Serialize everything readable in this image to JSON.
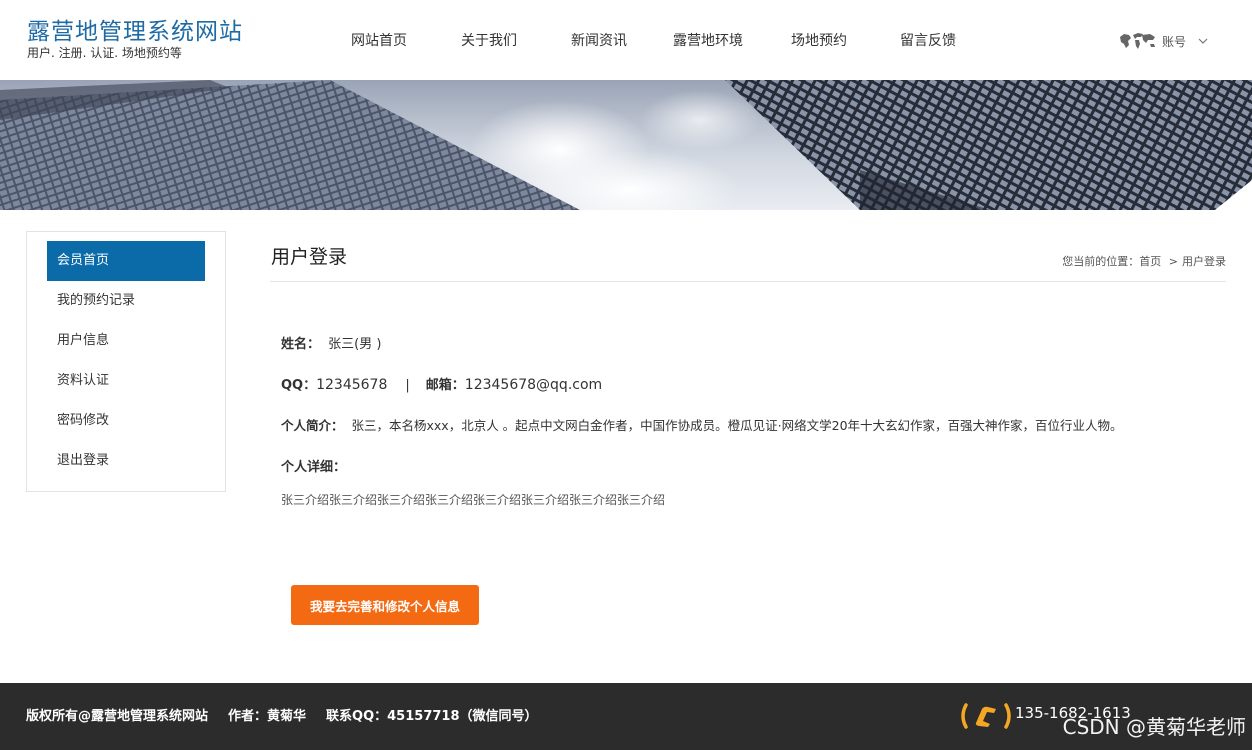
{
  "header": {
    "site_title": "露营地管理系统网站",
    "site_subtitle": "用户. 注册. 认证. 场地预约等",
    "nav": [
      {
        "label": "网站首页"
      },
      {
        "label": "关于我们"
      },
      {
        "label": "新闻资讯"
      },
      {
        "label": "露营地环境"
      },
      {
        "label": "场地预约"
      },
      {
        "label": "留言反馈"
      }
    ],
    "account_label": "账号",
    "account_icon": "world-map-icon"
  },
  "sidebar": {
    "items": [
      {
        "label": "会员首页",
        "active": true
      },
      {
        "label": "我的预约记录"
      },
      {
        "label": "用户信息"
      },
      {
        "label": "资料认证"
      },
      {
        "label": "密码修改"
      },
      {
        "label": "退出登录"
      }
    ]
  },
  "main": {
    "title": "用户登录",
    "breadcrumb": {
      "prefix": "您当前的位置：",
      "home": "首页",
      "separator": ">",
      "current": "用户登录"
    },
    "profile": {
      "name_label": "姓名：",
      "name_value": "张三(男 )",
      "qq_label": "QQ：",
      "qq_value": "12345678",
      "divider": "|",
      "email_label": "邮箱：",
      "email_value": "12345678@qq.com",
      "intro_label": "个人简介：",
      "intro_value": "张三，本名杨xxx，北京人 。起点中文网白金作者，中国作协成员。橙瓜见证·网络文学20年十大玄幻作家，百强大神作家，百位行业人物。",
      "detail_label": "个人详细：",
      "detail_value": "张三介绍张三介绍张三介绍张三介绍张三介绍张三介绍张三介绍张三介绍"
    },
    "edit_button": "我要去完善和修改个人信息"
  },
  "footer": {
    "copyright": "版权所有@露营地管理系统网站",
    "author": "作者：黄菊华",
    "contact": "联系QQ：45157718（微信同号）",
    "phone": "135-1682-1613",
    "watermark": "CSDN @黄菊华老师"
  },
  "colors": {
    "brand_blue": "#1d6aa5",
    "sidebar_active": "#0b6aa8",
    "button_orange": "#f46a12",
    "footer_bg": "#2c2c2c",
    "phone_icon": "#f5a623"
  }
}
